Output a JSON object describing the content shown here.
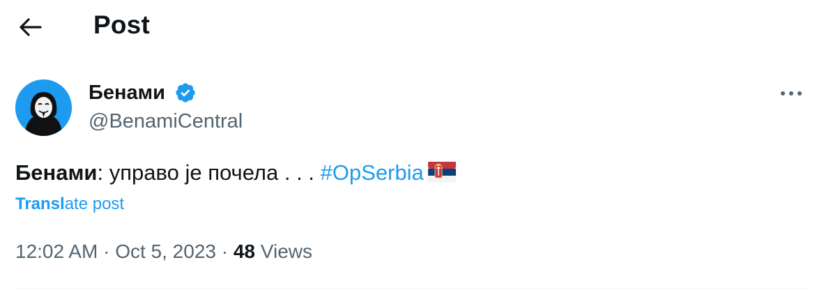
{
  "header": {
    "title": "Post"
  },
  "author": {
    "display_name": "Бенами",
    "handle": "@BenamiCentral",
    "verified": true,
    "badge_color": "#1d9bf0"
  },
  "post": {
    "author_prefix": "Бенами",
    "separator": ":",
    "body": " управо је почела . . . ",
    "hashtag": "#OpSerbia",
    "emoji": "Serbian flag"
  },
  "translate": {
    "part1": "Transl",
    "part2": "ate post"
  },
  "meta": {
    "time": "12:02 AM",
    "dot": "·",
    "date": "Oct 5, 2023",
    "views_count": "48",
    "views_label": "Views"
  },
  "colors": {
    "accent": "#1d9bf0",
    "secondary_text": "#536471",
    "primary_text": "#0f1419"
  },
  "icons": [
    "back-arrow-icon",
    "verified-badge-icon",
    "more-icon",
    "serbia-flag-icon"
  ]
}
